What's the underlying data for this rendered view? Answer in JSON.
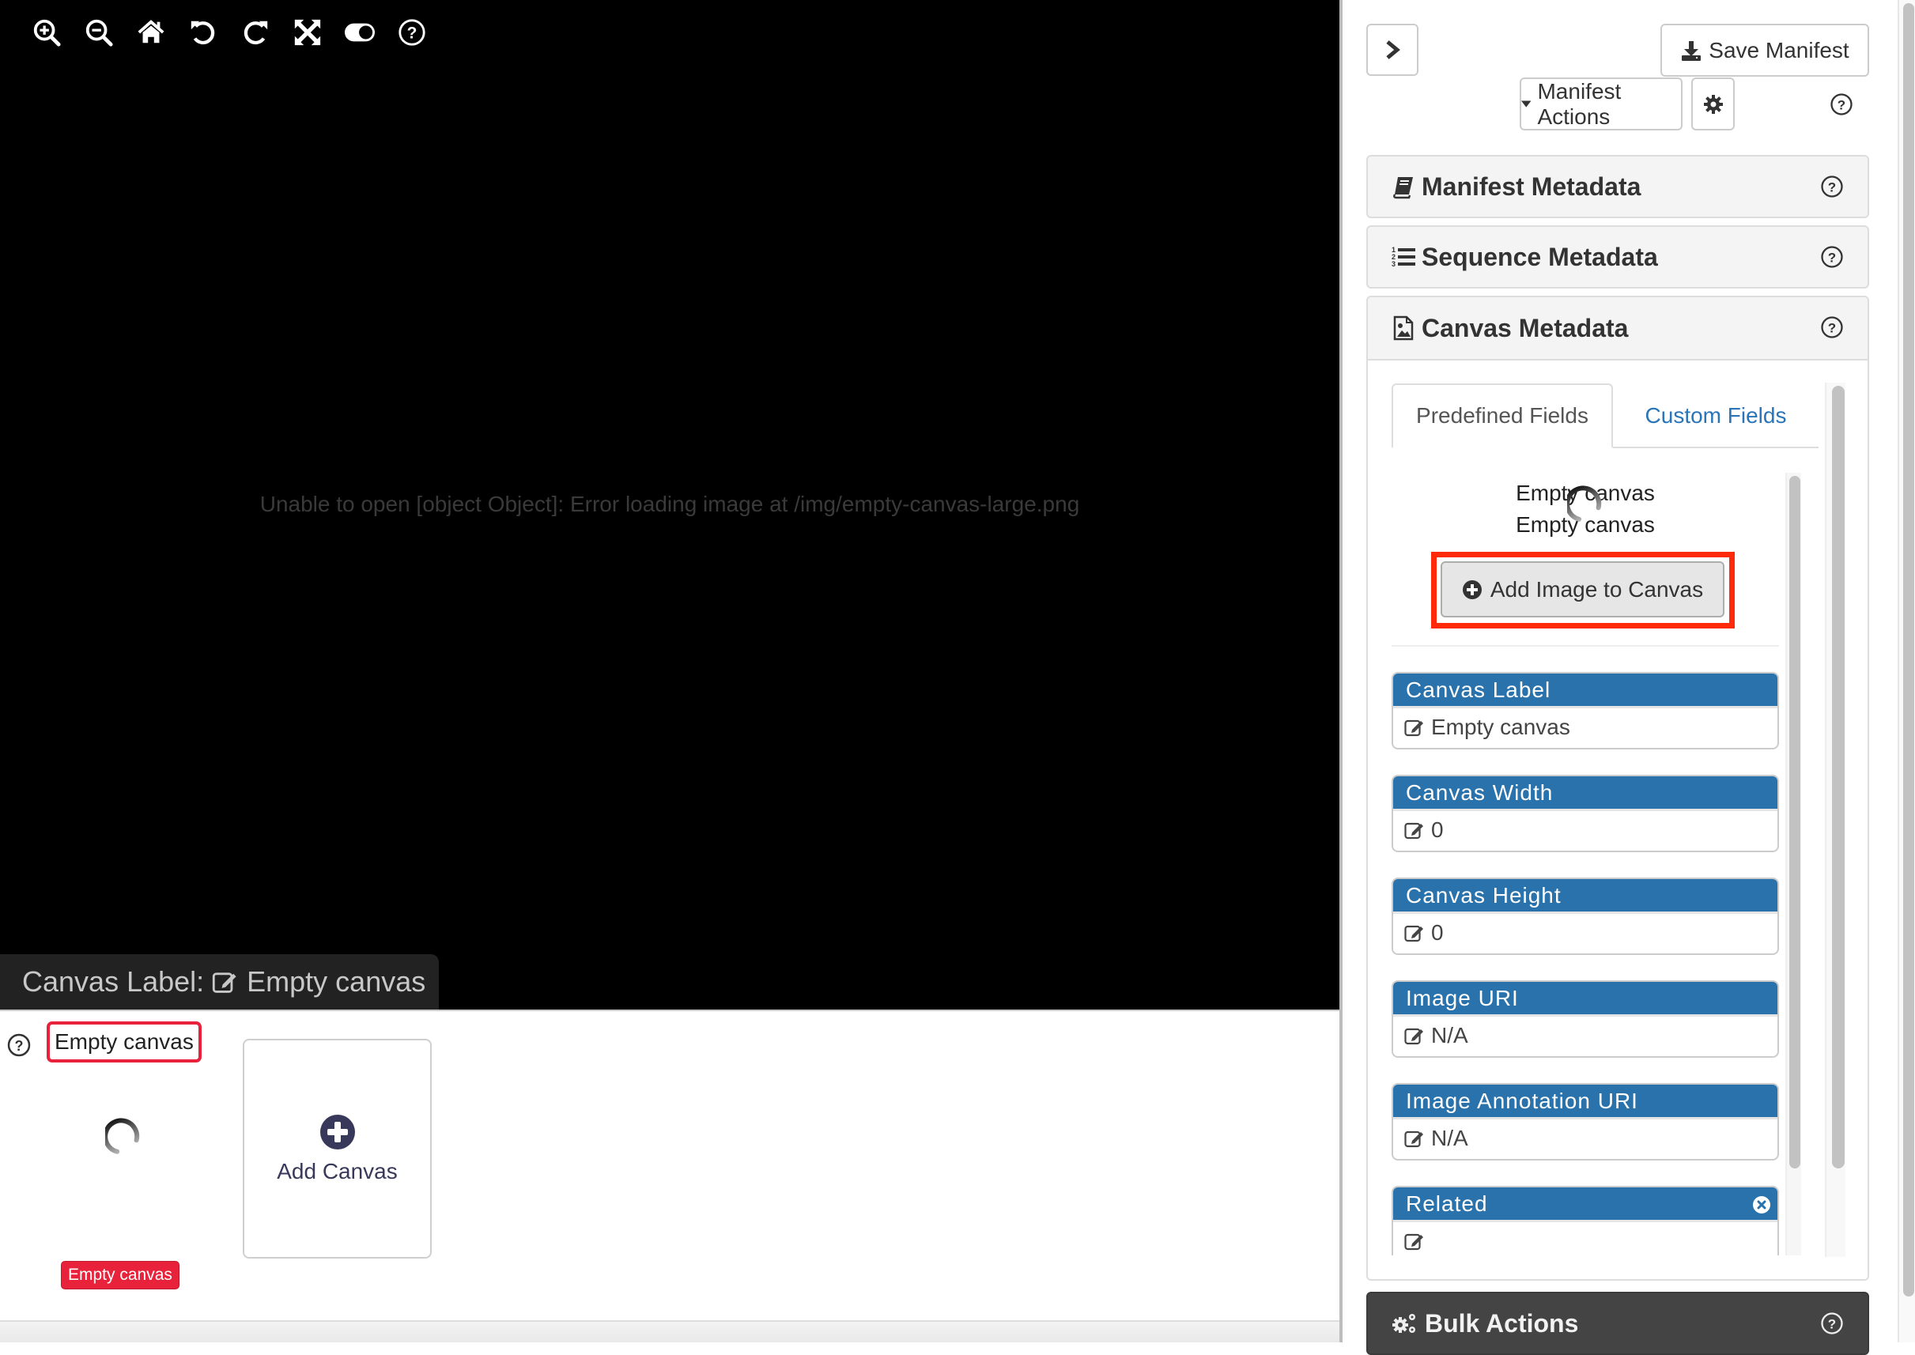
{
  "viewer": {
    "toolbar": [
      {
        "name": "zoom-in-button",
        "icon": "zoom-in-icon"
      },
      {
        "name": "zoom-out-button",
        "icon": "zoom-out-icon"
      },
      {
        "name": "home-button",
        "icon": "home-icon"
      },
      {
        "name": "rotate-left-button",
        "icon": "rotate-left-icon"
      },
      {
        "name": "rotate-right-button",
        "icon": "rotate-right-icon"
      },
      {
        "name": "fullscreen-button",
        "icon": "expand-icon"
      },
      {
        "name": "toggle-button",
        "icon": "toggle-icon"
      },
      {
        "name": "help-button",
        "icon": "question-circle-icon"
      }
    ],
    "error_message": "Unable to open [object Object]: Error loading image at /img/empty-canvas-large.png",
    "canvas_label_prefix": "Canvas Label:",
    "canvas_label_value": "Empty canvas"
  },
  "filmstrip": {
    "selected_title": "Empty canvas",
    "thumbnail_badge": "Empty canvas",
    "add_canvas_label": "Add Canvas"
  },
  "panel": {
    "save_label": "Save Manifest",
    "actions_label": "Manifest Actions",
    "sections": {
      "manifest": "Manifest Metadata",
      "sequence": "Sequence Metadata",
      "canvas": "Canvas Metadata",
      "bulk": "Bulk Actions"
    },
    "tabs": {
      "predefined": "Predefined Fields",
      "custom": "Custom Fields"
    },
    "canvas_preview": {
      "line1": "Empty canvas",
      "line2": "Empty canvas",
      "add_image_label": "Add Image to Canvas"
    },
    "fields": [
      {
        "label": "Canvas Label",
        "value": "Empty canvas",
        "removable": false
      },
      {
        "label": "Canvas Width",
        "value": "0",
        "removable": false
      },
      {
        "label": "Canvas Height",
        "value": "0",
        "removable": false
      },
      {
        "label": "Image URI",
        "value": "N/A",
        "removable": false
      },
      {
        "label": "Image Annotation URI",
        "value": "N/A",
        "removable": false
      },
      {
        "label": "Related",
        "value": "",
        "removable": true
      }
    ]
  },
  "colors": {
    "field_header": "#2a72ab",
    "highlight": "#ff2a0a",
    "badge": "#e8223a",
    "link": "#2a75b7"
  }
}
